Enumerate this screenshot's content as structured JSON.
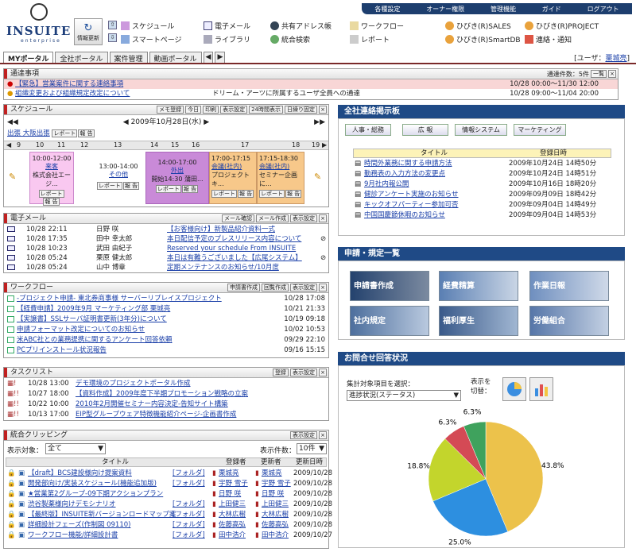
{
  "header": {
    "brand": "INSUITE",
    "brand_sub": "enterprise",
    "top_links": [
      "各種設定",
      "オーナー権限",
      "管理機能",
      "ガイド",
      "ログアウト"
    ],
    "update_btn": "情報更新",
    "apps_row1": [
      "スケジュール",
      "電子メール",
      "共有アドレス帳",
      "ワークフロー",
      "ひびき(R)SALES",
      "ひびき(R)PROJECT"
    ],
    "apps_row2": [
      "スマートページ",
      "ライブラリ",
      "統合検索",
      "レポート",
      "ひびき(R)SmartDB",
      "連絡・通知"
    ]
  },
  "tabs": [
    "MYポータル",
    "全社ポータル",
    "案件管理",
    "動画ポータル"
  ],
  "user": {
    "label": "[ユーザ：",
    "name": "栗城亮",
    "close": "]"
  },
  "notices": {
    "title": "通達事項",
    "count": "通達件数：5件",
    "btn": "一覧",
    "items": [
      {
        "text": "【緊急】営業案件に関する連絡事項",
        "info": "10/28 00:00～11/30 12:00"
      },
      {
        "text": "組織変更および組織規定改定について",
        "sep": "ドリーム・アーツに所属するユーザ全員への通達",
        "info": "10/28 09:00～11/04 20:00"
      }
    ]
  },
  "schedule": {
    "title": "スケジュール",
    "buttons": [
      "メモ登録",
      "今日",
      "印刷",
      "表示設定",
      "24時間表示",
      "日繰り固定"
    ],
    "date": "2009年10月28日(水)",
    "place": "出張 大阪出張",
    "report": "レポート",
    "reply": "報 告",
    "hours": [
      "9",
      "10",
      "11",
      "12",
      "13",
      "14",
      "15",
      "16",
      "17",
      "18",
      "19"
    ],
    "events": [
      {
        "time": "10:00-12:00",
        "title": "来客",
        "desc": "株式会社エージ..."
      },
      {
        "time": "13:00-14:00",
        "title": "その他"
      },
      {
        "time": "14:00-17:00",
        "title": "外出",
        "desc": "開始14:30 蒲田..."
      },
      {
        "time": "17:00-17:15",
        "title": "会議(社内)",
        "desc": "プロジェクト キ..."
      },
      {
        "time": "17:15-18:30",
        "title": "会議(社内)",
        "desc": "セミナー企画に..."
      }
    ]
  },
  "mail": {
    "title": "電子メール",
    "buttons": [
      "メール確認",
      "メール作成",
      "表示設定"
    ],
    "rows": [
      {
        "date": "10/28 22:11",
        "from": "日野 咲",
        "subject": "【お客様向け】新製品紹介資料一式"
      },
      {
        "date": "10/28 17:35",
        "from": "田中 幸太郎",
        "subject": "本日配信予定のプレスリリース内容について"
      },
      {
        "date": "10/28 10:23",
        "from": "武田 由紀子",
        "subject": "Reserved your schedule From INSUITE"
      },
      {
        "date": "10/28 05:24",
        "from": "栗原 健太郎",
        "subject": "本日は有難うございました【広尾システム】"
      },
      {
        "date": "10/28 05:24",
        "from": "山中 博章",
        "subject": "定期メンテナンスのお知らせ/10月度"
      }
    ]
  },
  "workflow": {
    "title": "ワークフロー",
    "buttons": [
      "申請書作成",
      "回覧作成",
      "表示設定"
    ],
    "rows": [
      {
        "t": "-プロジェクト申請- 東北券商事様 サーバーリプレイスプロジェクト",
        "d": "10/28 17:08"
      },
      {
        "t": "【経費申請】2009年9月 マーケティング部 栗城亮",
        "d": "10/21 21:33"
      },
      {
        "t": "【実譲書】SSLサーバ証明書更新(3年分)について",
        "d": "10/19 09:18"
      },
      {
        "t": "申請フォーマット改定についてのお知らせ",
        "d": "10/02 10:53"
      },
      {
        "t": "米ABC社との業務提携に関するアンケート回答依頼",
        "d": "09/29 22:10"
      },
      {
        "t": "PCプリインストール状況報告",
        "d": "09/16 15:15"
      }
    ]
  },
  "tasks": {
    "title": "タスクリスト",
    "buttons": [
      "登録",
      "表示設定"
    ],
    "rows": [
      {
        "t": "10/28 13:00",
        "s": "デモ環境のプロジェクトポータル作成"
      },
      {
        "t": "10/27 18:00",
        "s": "【資料作成】2009年度下半期プロモーション戦略の立案"
      },
      {
        "t": "10/22 10:00",
        "s": "2010年2月開催セミナー内容決定-告知サイト構築"
      },
      {
        "t": "10/13 17:00",
        "s": "EIP型グループウェア特徴機能紹介ページ-企画書作成"
      }
    ]
  },
  "clip": {
    "title": "統合クリッピング",
    "buttons": [
      "表示設定"
    ],
    "filter_label": "表示対象：",
    "filter_value": "全て",
    "count_label": "表示件数：",
    "count_value": "10件",
    "cols": [
      "タイトル",
      "登録者",
      "更新者",
      "更新日時"
    ],
    "rows": [
      {
        "t": "【draft】BCS建設様向け提案資料",
        "f": "[フォルダ]",
        "r": "栗城亮",
        "u": "栗城亮",
        "d": "2009/10/28"
      },
      {
        "t": "開発部向け/実装スケジュール(機能追加版)",
        "f": "[フォルダ]",
        "r": "宇野 雪子",
        "u": "宇野 雪子",
        "d": "2009/10/28"
      },
      {
        "t": "★営業第2グループ-09下期アクションプラン",
        "f": "",
        "r": "日野 咲",
        "u": "日野 咲",
        "d": "2009/10/28"
      },
      {
        "t": "渋谷製薬様向けデモシナリオ",
        "f": "[フォルダ]",
        "r": "上田健三",
        "u": "上田健三",
        "d": "2009/10/28"
      },
      {
        "t": "【最終版】INSUITE新バージョンロードマップ案",
        "f": "[フォルダ]",
        "r": "大林広樹",
        "u": "大林広樹",
        "d": "2009/10/28"
      },
      {
        "t": "詳細設計フェーズ(作制図 09110)",
        "f": "[フォルダ]",
        "r": "佐藤高弘",
        "u": "佐藤高弘",
        "d": "2009/10/28"
      },
      {
        "t": "ワークフロー機能/詳細設計書",
        "f": "[フォルダ]",
        "r": "田中浩介",
        "u": "田中浩介",
        "d": "2009/10/27"
      }
    ]
  },
  "board": {
    "title": "全社連絡掲示板",
    "cats": [
      "人事・総務",
      "広 報",
      "情報システム",
      "マーケティング"
    ],
    "cols": [
      "タイトル",
      "登録日時"
    ],
    "rows": [
      {
        "t": "時間外業務に関する申請方法",
        "d": "2009年10月24日 14時50分"
      },
      {
        "t": "勤務表の入力方法の変更点",
        "d": "2009年10月24日 14時51分"
      },
      {
        "t": "9月社内報公開",
        "d": "2009年10月16日 18時20分"
      },
      {
        "t": "健診アンケート実施のお知らせ",
        "d": "2009年09月09日 18時42分"
      },
      {
        "t": "キックオフパーティー参加可否",
        "d": "2009年09月04日 14時49分"
      },
      {
        "t": "中国国慶節休暇のお知らせ",
        "d": "2009年09月04日 14時53分"
      }
    ]
  },
  "forms": {
    "title": "申請・規定一覧",
    "tiles": [
      "申請書作成",
      "経費精算",
      "作業日報",
      "社内規定",
      "福利厚生",
      "労働組合"
    ]
  },
  "inquiry": {
    "title": "お問合せ回答状況",
    "select_label": "集計対象項目を選択：",
    "select_value": "進捗状況(ステータス)",
    "switch_label": "表示を切替："
  },
  "chart_data": {
    "type": "pie",
    "title": "",
    "values": [
      43.8,
      25.0,
      18.8,
      6.3,
      6.3
    ],
    "labels": [
      "43.8%",
      "25.0%",
      "18.8%",
      "6.3%",
      "6.3%"
    ],
    "colors": [
      "#ecc24b",
      "#2d8fe0",
      "#c3d52c",
      "#d44a55",
      "#3fa25d"
    ]
  }
}
